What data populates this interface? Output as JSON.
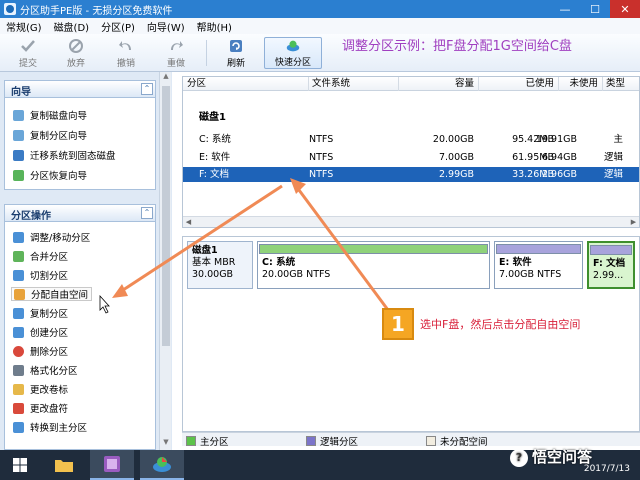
{
  "window": {
    "title": "分区助手PE版 - 无损分区免费软件",
    "minimize_glyph": "—",
    "maximize_glyph": "☐",
    "close_glyph": "✕"
  },
  "menu": [
    "常规(G)",
    "磁盘(D)",
    "分区(P)",
    "向导(W)",
    "帮助(H)"
  ],
  "toolbar": {
    "submit": "提交",
    "discard": "放弃",
    "undo": "撤销",
    "redo": "重做",
    "refresh": "刷新",
    "quick_partition": "快速分区"
  },
  "banner": "调整分区示例：把F盘分配1G空间给C盘",
  "wizard_panel": {
    "title": "向导",
    "collapse_glyph": "⌃",
    "items": [
      "复制磁盘向导",
      "复制分区向导",
      "迁移系统到固态磁盘",
      "分区恢复向导"
    ]
  },
  "ops_panel": {
    "title": "分区操作",
    "collapse_glyph": "⌃",
    "items": [
      "调整/移动分区",
      "合并分区",
      "切割分区",
      "分配自由空间",
      "复制分区",
      "创建分区",
      "删除分区",
      "格式化分区",
      "更改卷标",
      "更改盘符",
      "转换到主分区"
    ]
  },
  "partition_table": {
    "columns": [
      "分区",
      "文件系统",
      "容量",
      "已使用",
      "未使用",
      "类型"
    ],
    "disk_label": "磁盘1",
    "rows": [
      {
        "name": "C: 系统",
        "fs": "NTFS",
        "capacity": "20.00GB",
        "used": "95.42MB",
        "free": "19.91GB",
        "type": "主"
      },
      {
        "name": "E: 软件",
        "fs": "NTFS",
        "capacity": "7.00GB",
        "used": "61.95MB",
        "free": "6.94GB",
        "type": "逻辑"
      },
      {
        "name": "F: 文档",
        "fs": "NTFS",
        "capacity": "2.99GB",
        "used": "33.26MB",
        "free": "2.96GB",
        "type": "逻辑"
      }
    ]
  },
  "disk_map": {
    "disk_name": "磁盘1",
    "disk_type": "基本 MBR",
    "disk_size": "30.00GB",
    "partitions": [
      {
        "name": "C: 系统",
        "info": "20.00GB NTFS",
        "bar_color": "#8fd27a"
      },
      {
        "name": "E: 软件",
        "info": "7.00GB NTFS",
        "bar_color": "#a8a3dc"
      },
      {
        "name": "F: 文档",
        "info": "2.99...",
        "bar_color": "#a8a3dc"
      }
    ]
  },
  "legend": {
    "primary": "主分区",
    "logical": "逻辑分区",
    "unallocated": "未分配空间",
    "primary_color": "#5cc24a",
    "logical_color": "#7b74c9",
    "unallocated_color": "#f2ede0"
  },
  "annotation": {
    "badge": "1",
    "text": "选中F盘，然后点击分配自由空间"
  },
  "taskbar": {
    "date": "2017/7/13",
    "watermark": "悟空问答",
    "watermark_icon": "?"
  },
  "colors": {
    "title_bar": "#2b7fd0",
    "selection": "#1e63b8",
    "banner_text": "#a040c0",
    "annotation_red": "#d8203a",
    "badge_orange": "#f5a623"
  }
}
